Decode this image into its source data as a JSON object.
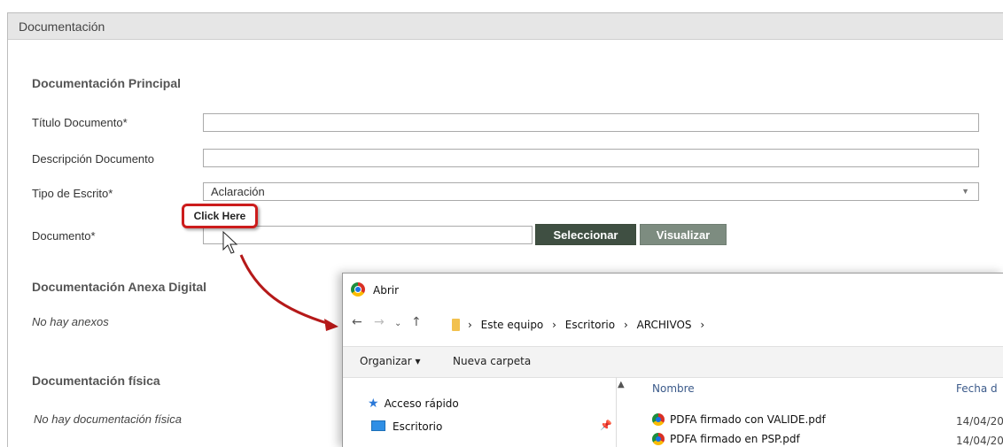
{
  "header": {
    "title": "Documentación"
  },
  "principal": {
    "title": "Documentación Principal",
    "titulo_label": "Título Documento*",
    "titulo_value": "",
    "descripcion_label": "Descripción Documento",
    "descripcion_value": "",
    "tipo_label": "Tipo de Escrito*",
    "tipo_value": "Aclaración",
    "documento_label": "Documento*",
    "documento_value": "",
    "seleccionar_label": "Seleccionar",
    "visualizar_label": "Visualizar"
  },
  "callout": {
    "text": "Click Here"
  },
  "anexa": {
    "title": "Documentación Anexa Digital",
    "empty_text": "No hay anexos"
  },
  "fisica": {
    "title": "Documentación física",
    "empty_text": "No hay documentación física"
  },
  "dialog": {
    "title": "Abrir",
    "breadcrumb": [
      "Este equipo",
      "Escritorio",
      "ARCHIVOS"
    ],
    "organize_label": "Organizar ▾",
    "new_folder_label": "Nueva carpeta",
    "nav": {
      "quick_access": "Acceso rápido",
      "desktop": "Escritorio"
    },
    "columns": {
      "name": "Nombre",
      "date": "Fecha d"
    },
    "files": [
      {
        "name": "PDFA firmado con VALIDE.pdf",
        "date": "14/04/20"
      },
      {
        "name": "PDFA firmado en PSP.pdf",
        "date": "14/04/20"
      }
    ]
  },
  "icons": [
    "chrome-icon",
    "folder-icon",
    "star-icon",
    "desktop-icon",
    "pin-icon",
    "cursor-icon",
    "arrow-icon"
  ],
  "colors": {
    "primary_button": "#3f4f42",
    "secondary_button": "#7d8c80",
    "callout_border": "#cc1c1c"
  }
}
